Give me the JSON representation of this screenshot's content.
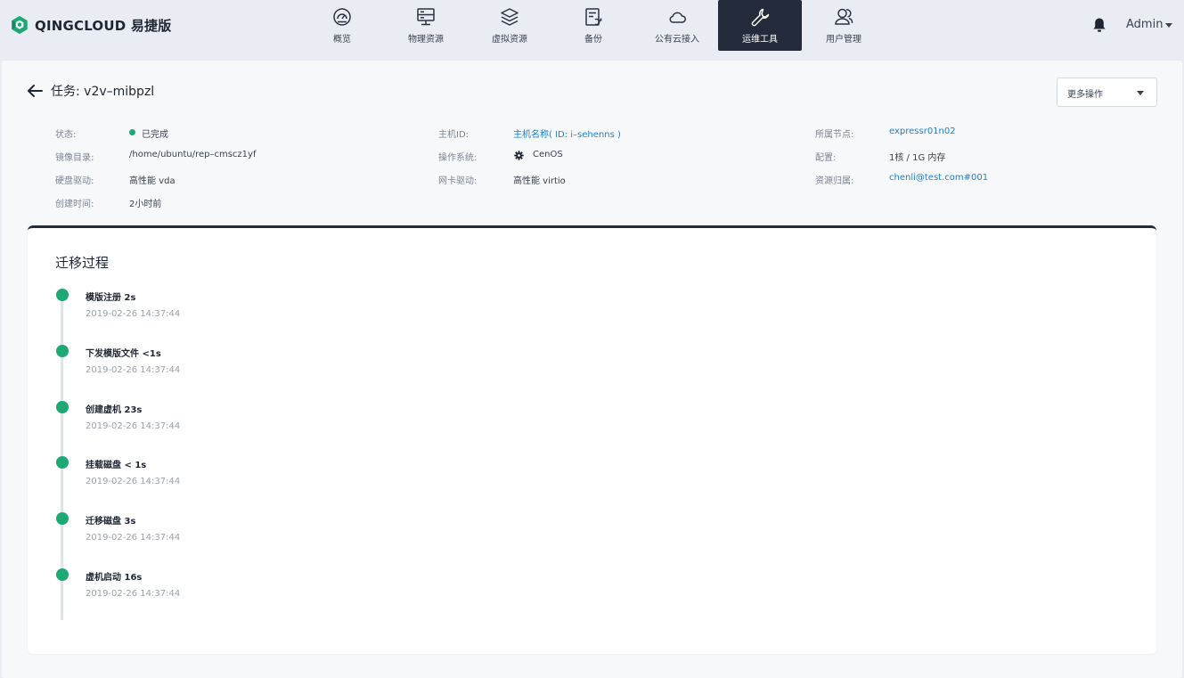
{
  "brand": {
    "name": "QINGCLOUD 易捷版",
    "color": "#1ea873"
  },
  "nav": {
    "items": [
      {
        "label": "概览",
        "icon": "dashboard-gauge-icon"
      },
      {
        "label": "物理资源",
        "icon": "server-monitor-icon"
      },
      {
        "label": "虚拟资源",
        "icon": "layers-icon"
      },
      {
        "label": "备份",
        "icon": "backup-document-icon"
      },
      {
        "label": "公有云接入",
        "icon": "cloud-icon"
      },
      {
        "label": "运维工具",
        "icon": "wrench-icon",
        "active": true
      },
      {
        "label": "用户管理",
        "icon": "users-icon"
      }
    ],
    "active_bg": "#242b3a"
  },
  "header": {
    "user": "Admin",
    "notification_icon": "bell-icon"
  },
  "task": {
    "title": "任务: v2v–mibpzl",
    "more_actions": "更多操作"
  },
  "info": {
    "status": {
      "label": "状态:",
      "value": "已完成",
      "color": "#1ea873"
    },
    "image_dir": {
      "label": "镜像目录:",
      "value": "/home/ubuntu/rep–cmscz1yf"
    },
    "disk_driver": {
      "label": "硬盘驱动:",
      "value": "高性能 vda"
    },
    "created": {
      "label": "创建时间:",
      "value": "2小时前"
    },
    "host_id": {
      "label": "主机ID:",
      "value": "主机名称( ID: i–sehenns )"
    },
    "os": {
      "label": "操作系统:",
      "value": "CenOS",
      "icon": "os-gear-icon"
    },
    "nic_driver": {
      "label": "网卡驱动:",
      "value": "高性能 virtio"
    },
    "node": {
      "label": "所属节点:",
      "value": "expressr01n02"
    },
    "config": {
      "label": "配置:",
      "value": "1核 / 1G 内存"
    },
    "owner": {
      "label": "资源归属:",
      "value": "chenli@test.com#001"
    }
  },
  "process": {
    "title": "迁移过程",
    "steps": [
      {
        "name": "模版注册  2s",
        "time": "2019-02-26 14:37:44"
      },
      {
        "name": "下发模版文件 <1s",
        "time": "2019-02-26 14:37:44"
      },
      {
        "name": "创建虚机 23s",
        "time": "2019-02-26 14:37:44"
      },
      {
        "name": "挂载磁盘 < 1s",
        "time": "2019-02-26 14:37:44"
      },
      {
        "name": "迁移磁盘 3s",
        "time": "2019-02-26 14:37:44"
      },
      {
        "name": "虚机启动 16s",
        "time": "2019-02-26 14:37:44"
      }
    ]
  }
}
